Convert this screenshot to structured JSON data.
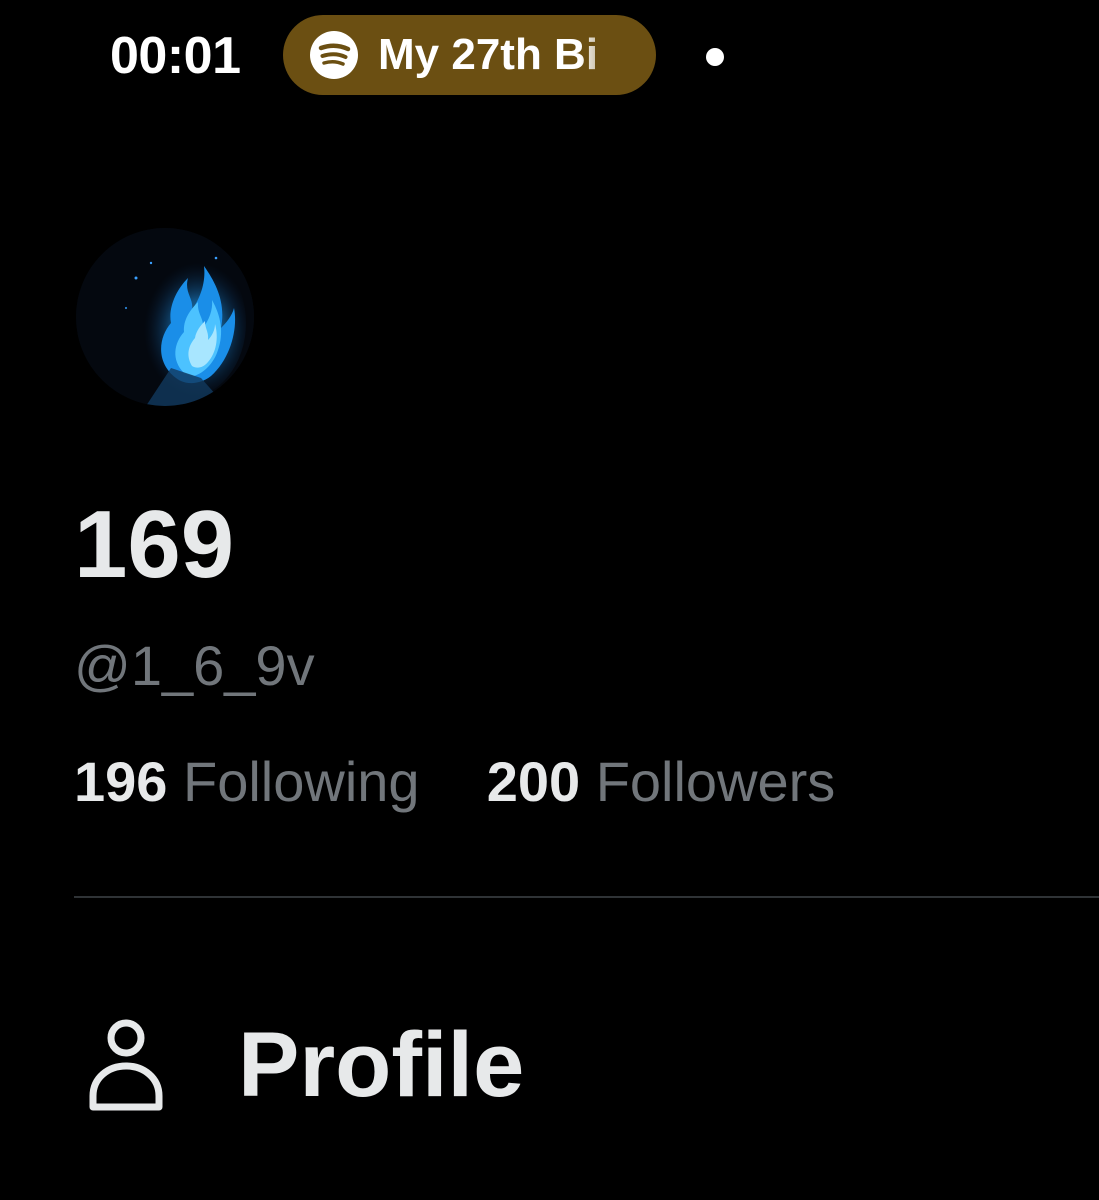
{
  "status_bar": {
    "time": "00:01",
    "media_title": "My 27th Bi"
  },
  "profile": {
    "display_name": "169",
    "handle": "@1_6_9v",
    "following_count": "196",
    "following_label": "Following",
    "followers_count": "200",
    "followers_label": "Followers"
  },
  "menu": {
    "items": [
      {
        "label": "Profile",
        "icon": "person-icon"
      }
    ]
  },
  "colors": {
    "background": "#000000",
    "primary_text": "#e7e9ea",
    "secondary_text": "#71767b",
    "media_pill": "#6b4f12",
    "divider": "#2f3336"
  }
}
